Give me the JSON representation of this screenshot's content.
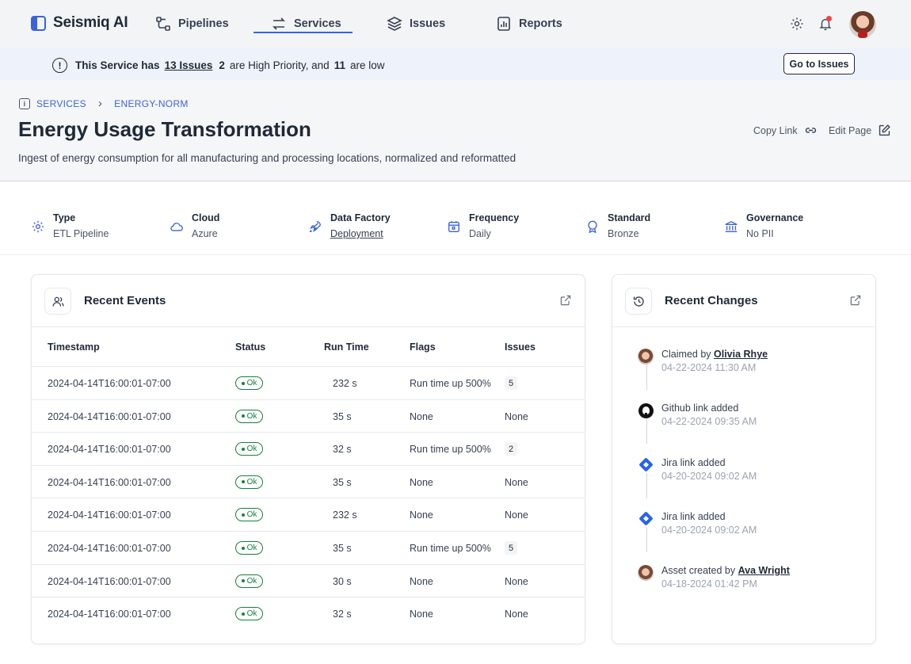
{
  "app": {
    "name": "Seismiq AI"
  },
  "nav": {
    "items": [
      {
        "label": "Pipelines",
        "icon": "pipelines-icon"
      },
      {
        "label": "Services",
        "icon": "services-icon",
        "active": true
      },
      {
        "label": "Issues",
        "icon": "issues-icon"
      },
      {
        "label": "Reports",
        "icon": "reports-icon"
      }
    ]
  },
  "banner": {
    "prefix": "This Service has",
    "issues_link": "13 Issues",
    "high_count": "2",
    "mid": "are High Priority, and",
    "low_count": "11",
    "suffix": "are low",
    "button": "Go to Issues"
  },
  "breadcrumb": {
    "root": "SERVICES",
    "current": "ENERGY-NORM"
  },
  "page": {
    "title": "Energy Usage Transformation",
    "description": "Ingest of energy consumption for all manufacturing and processing locations, normalized and reformatted",
    "copy_link": "Copy Link",
    "edit_page": "Edit Page"
  },
  "properties": [
    {
      "label": "Type",
      "value": "ETL Pipeline",
      "icon": "gear-icon"
    },
    {
      "label": "Cloud",
      "value": "Azure",
      "icon": "cloud-icon"
    },
    {
      "label": "Data Factory",
      "value": "Deployment",
      "icon": "rocket-icon",
      "link": true
    },
    {
      "label": "Frequency",
      "value": "Daily",
      "icon": "calendar-icon"
    },
    {
      "label": "Standard",
      "value": "Bronze",
      "icon": "award-icon"
    },
    {
      "label": "Governance",
      "value": "No PII",
      "icon": "bank-icon"
    }
  ],
  "events": {
    "title": "Recent Events",
    "columns": [
      "Timestamp",
      "Status",
      "Run Time",
      "Flags",
      "Issues"
    ],
    "rows": [
      {
        "timestamp": "2024-04-14T16:00:01-07:00",
        "status": "Ok",
        "run_time": "232 s",
        "flags": "Run time up 500%",
        "issues": "5"
      },
      {
        "timestamp": "2024-04-14T16:00:01-07:00",
        "status": "Ok",
        "run_time": "35 s",
        "flags": "None",
        "issues": "None"
      },
      {
        "timestamp": "2024-04-14T16:00:01-07:00",
        "status": "Ok",
        "run_time": "32 s",
        "flags": "Run time up 500%",
        "issues": "2"
      },
      {
        "timestamp": "2024-04-14T16:00:01-07:00",
        "status": "Ok",
        "run_time": "35 s",
        "flags": "None",
        "issues": "None"
      },
      {
        "timestamp": "2024-04-14T16:00:01-07:00",
        "status": "Ok",
        "run_time": "232 s",
        "flags": "None",
        "issues": "None"
      },
      {
        "timestamp": "2024-04-14T16:00:01-07:00",
        "status": "Ok",
        "run_time": "35 s",
        "flags": "Run time up 500%",
        "issues": "5"
      },
      {
        "timestamp": "2024-04-14T16:00:01-07:00",
        "status": "Ok",
        "run_time": "30 s",
        "flags": "None",
        "issues": "None"
      },
      {
        "timestamp": "2024-04-14T16:00:01-07:00",
        "status": "Ok",
        "run_time": "32 s",
        "flags": "None",
        "issues": "None"
      }
    ]
  },
  "changes": {
    "title": "Recent Changes",
    "items": [
      {
        "text": "Claimed by",
        "user": "Olivia Rhye",
        "date": "04-22-2024 11:30 AM",
        "icon": "avatar"
      },
      {
        "text": "Github link added",
        "user": "",
        "date": "04-22-2024 09:35 AM",
        "icon": "github-icon"
      },
      {
        "text": "Jira link added",
        "user": "",
        "date": "04-20-2024 09:02 AM",
        "icon": "jira-icon"
      },
      {
        "text": "Jira link added",
        "user": "",
        "date": "04-20-2024 09:02 AM",
        "icon": "jira-icon"
      },
      {
        "text": "Asset created by",
        "user": "Ava Wright",
        "date": "04-18-2024 01:42 PM",
        "icon": "avatar"
      }
    ]
  },
  "colors": {
    "accent": "#3b63d9",
    "ok": "#15803d",
    "alert": "#ef4444"
  }
}
